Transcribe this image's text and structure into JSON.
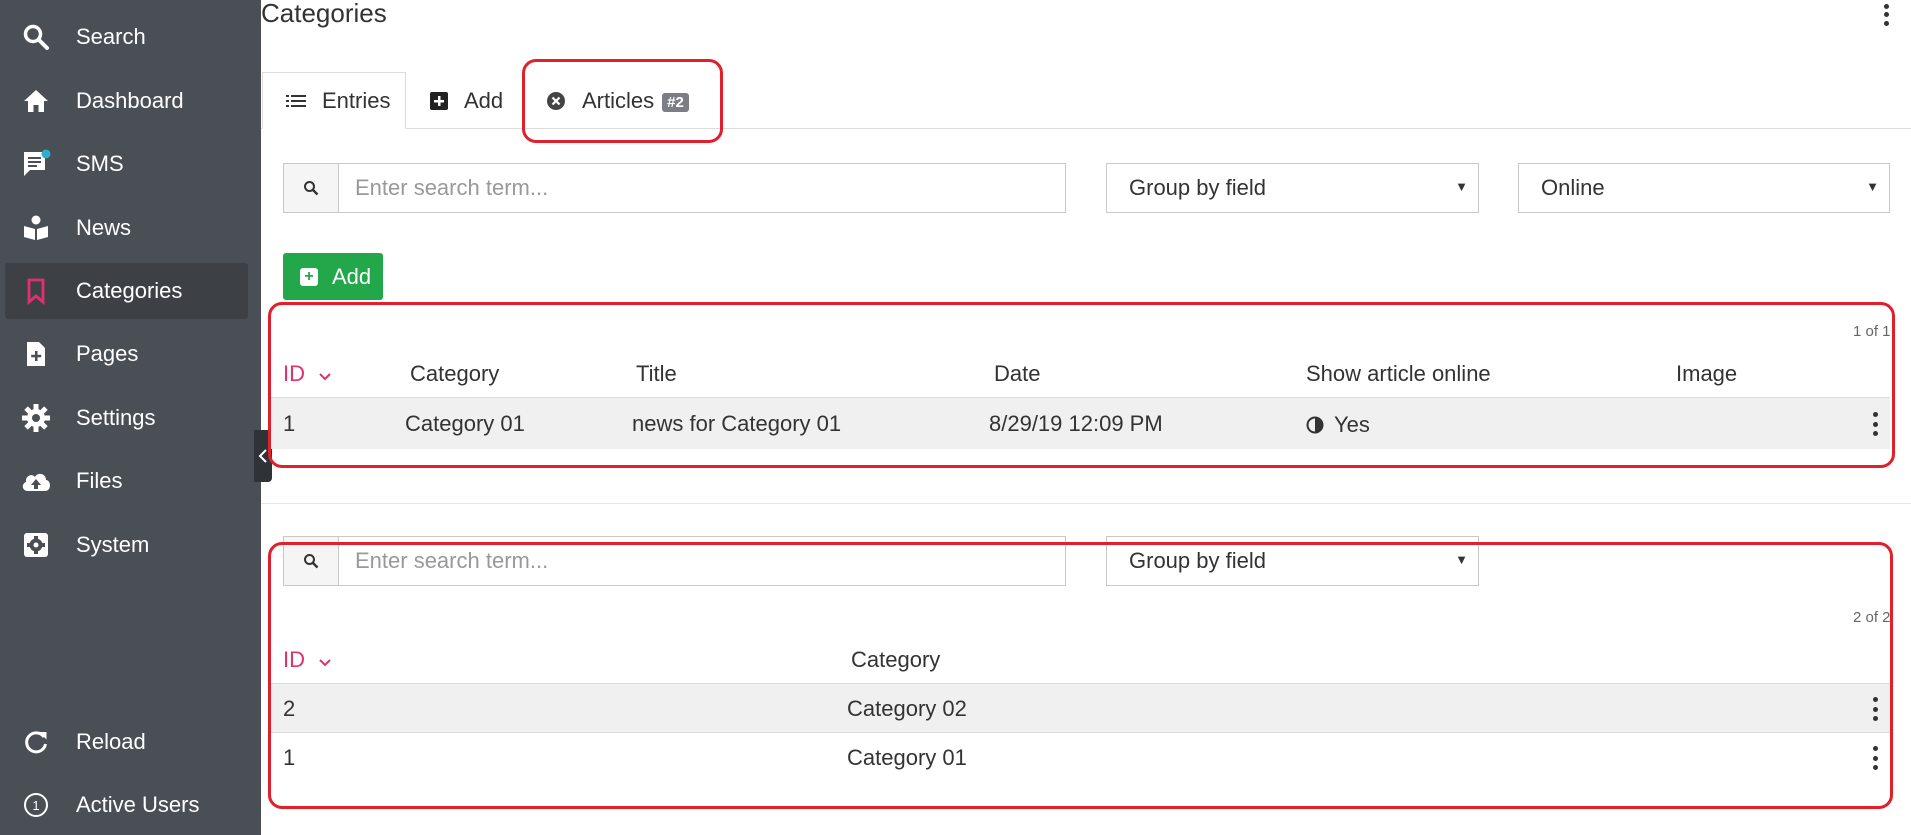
{
  "sidebar": {
    "items": [
      {
        "label": "Search",
        "icon": "search-icon"
      },
      {
        "label": "Dashboard",
        "icon": "home-icon"
      },
      {
        "label": "SMS",
        "icon": "chat-icon"
      },
      {
        "label": "News",
        "icon": "book-reader-icon"
      },
      {
        "label": "Categories",
        "icon": "bookmark-icon"
      },
      {
        "label": "Pages",
        "icon": "file-plus-icon"
      },
      {
        "label": "Settings",
        "icon": "gear-icon"
      },
      {
        "label": "Files",
        "icon": "cloud-upload-icon"
      },
      {
        "label": "System",
        "icon": "cog-box-icon"
      },
      {
        "label": "Reload",
        "icon": "refresh-icon"
      },
      {
        "label": "Active Users",
        "icon": "user-count-icon",
        "count": "1"
      }
    ],
    "active": "Categories",
    "accent_color": "#e0306f"
  },
  "header": {
    "title": "Categories"
  },
  "tabs": [
    {
      "label": "Entries",
      "icon": "list-icon"
    },
    {
      "label": "Add",
      "icon": "plus-square-icon"
    },
    {
      "label": "Articles",
      "icon": "close-circle-icon",
      "badge": "#2"
    }
  ],
  "filters_top": {
    "search_placeholder": "Enter search term...",
    "group_by": "Group by field",
    "status": "Online"
  },
  "add_button": {
    "label": "Add"
  },
  "table_top": {
    "pager": "1 of 1",
    "columns": [
      "ID",
      "Category",
      "Title",
      "Date",
      "Show article online",
      "Image"
    ],
    "rows": [
      {
        "id": "1",
        "category": "Category 01",
        "title": "news for Category 01",
        "date": "8/29/19 12:09 PM",
        "online": "Yes",
        "image": ""
      }
    ]
  },
  "filters_bottom": {
    "search_placeholder": "Enter search term...",
    "group_by": "Group by field"
  },
  "table_bottom": {
    "pager": "2 of 2",
    "columns": [
      "ID",
      "Category"
    ],
    "rows": [
      {
        "id": "2",
        "category": "Category 02"
      },
      {
        "id": "1",
        "category": "Category 01"
      }
    ]
  },
  "colors": {
    "highlight": "#e0202a",
    "add_green": "#22a84a",
    "sidebar_bg": "#4a4f55"
  }
}
